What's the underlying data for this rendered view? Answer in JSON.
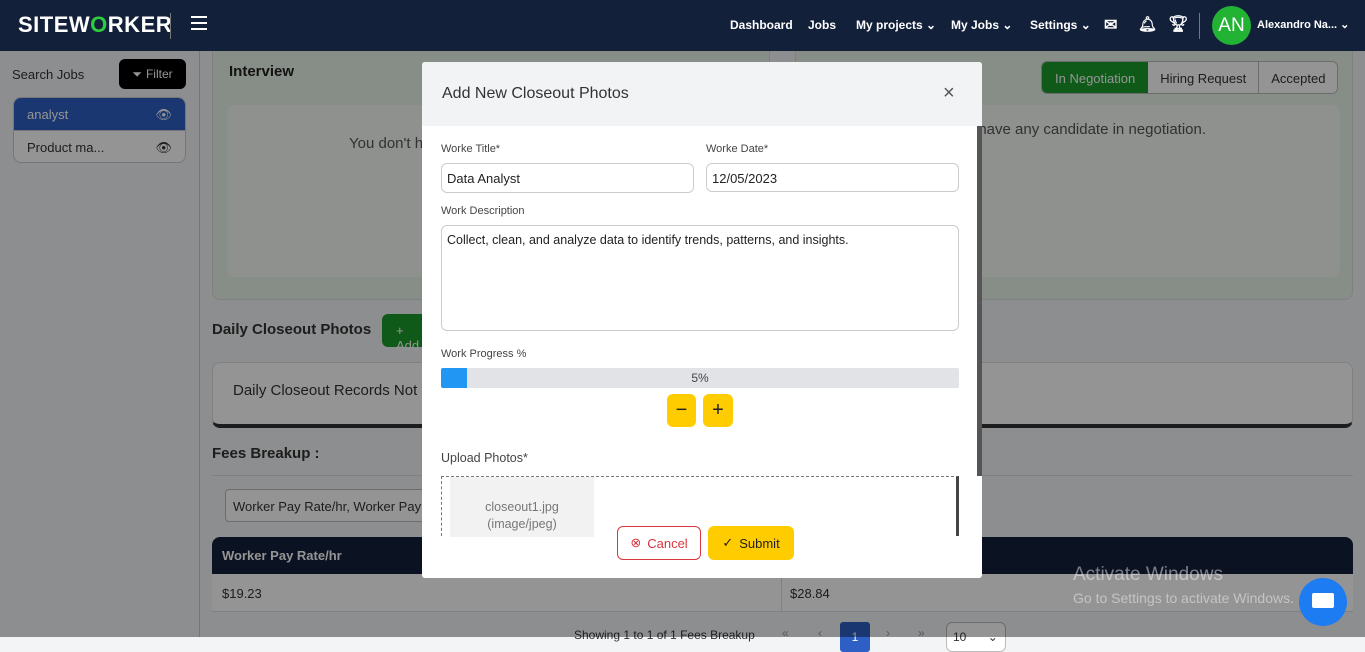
{
  "nav": {
    "logo": "SITEWORKER",
    "links": [
      "Dashboard",
      "Jobs",
      "My projects",
      "My Jobs",
      "Settings"
    ],
    "avatar_initials": "AN",
    "user_name": "Alexandro Na..."
  },
  "sidebar": {
    "search_label": "Search Jobs",
    "filter_label": "Filter",
    "items": [
      {
        "label": "analyst",
        "active": true
      },
      {
        "label": "Product ma...",
        "active": false
      }
    ]
  },
  "interview": {
    "title": "Interview",
    "empty_text": "You don't h"
  },
  "negotiation": {
    "tabs": [
      "In Negotiation",
      "Hiring Request",
      "Accepted"
    ],
    "active_tab": "In Negotiation",
    "empty_text": "t have any candidate in negotiation."
  },
  "closeout": {
    "title": "Daily Closeout Photos",
    "add_label": "+ Add",
    "empty_text": "Daily Closeout Records Not"
  },
  "fees": {
    "title": "Fees Breakup :",
    "select_value": "Worker Pay Rate/hr, Worker Pay R",
    "columns": [
      "Worker Pay Rate/hr",
      ""
    ],
    "rows": [
      [
        "$19.23",
        "$28.84"
      ]
    ],
    "pagination_text": "Showing 1 to 1 of 1 Fees Breakup",
    "current_page": "1",
    "page_size": "10"
  },
  "modal": {
    "title": "Add New Closeout Photos",
    "work_title_label": "Worke Title*",
    "work_title_value": "Data Analyst",
    "work_date_label": "Worke Date*",
    "work_date_value": "12/05/2023",
    "description_label": "Work Description",
    "description_value": "Collect, clean, and analyze data to identify trends, patterns, and insights.",
    "progress_label": "Work Progress %",
    "progress_percent": 5,
    "progress_text": "5%",
    "upload_label": "Upload Photos*",
    "file_name": "closeout1.jpg",
    "file_type": "(image/jpeg)",
    "cancel_label": "Cancel",
    "submit_label": "Submit"
  },
  "watermark": {
    "title": "Activate Windows",
    "subtitle": "Go to Settings to activate Windows."
  },
  "colors": {
    "navbar": "#13203a",
    "accent_green": "#1a9c2b",
    "yellow": "#ffcc00",
    "progress_blue": "#2196f3",
    "sidebar_active": "#2d5fc4"
  }
}
